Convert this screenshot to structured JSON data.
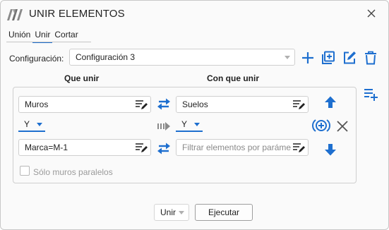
{
  "window": {
    "title": "UNIR ELEMENTOS"
  },
  "tabs": [
    {
      "label": "Unión"
    },
    {
      "label": "Unir"
    },
    {
      "label": "Cortar"
    }
  ],
  "config": {
    "label": "Configuración:",
    "selected": "Configuración 3"
  },
  "columns": {
    "left": "Que unir",
    "right": "Con que unir"
  },
  "rows": {
    "left_field1": "Muros",
    "right_field1": "Suelos",
    "left_operator": "Y",
    "right_operator": "Y",
    "left_field2": "Marca=M-1",
    "right_field2_placeholder": "Filtrar elementos por paráme"
  },
  "options": {
    "parallel_walls_label": "Sólo muros paralelos"
  },
  "footer": {
    "mode_selected": "Unir",
    "run_label": "Ejecutar"
  },
  "colors": {
    "accent": "#1e6fcf",
    "window_bg": "#fafafa"
  },
  "icons": [
    "app-logo-icon",
    "close-icon",
    "add-icon",
    "duplicate-icon",
    "edit-icon",
    "delete-icon",
    "add-list-icon",
    "swap-icon",
    "flow-arrow-icon",
    "add-circle-icon",
    "remove-icon",
    "arrow-up-icon",
    "arrow-down-icon",
    "edit-filter-icon"
  ]
}
